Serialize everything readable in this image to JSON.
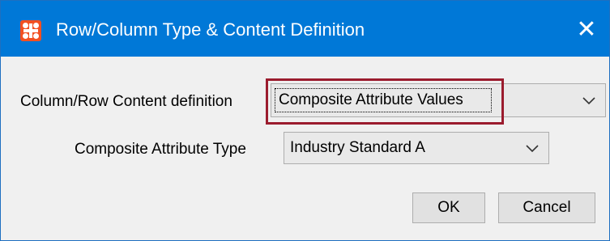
{
  "window": {
    "title": "Row/Column Type & Content Definition",
    "close_glyph": "✕",
    "accent_color": "#0078d7",
    "highlight_color": "#9b1c2e"
  },
  "form": {
    "content_definition": {
      "label": "Column/Row Content definition",
      "value": "Composite Attribute Values"
    },
    "attribute_type": {
      "label": "Composite Attribute Type",
      "value": "Industry Standard A"
    }
  },
  "buttons": {
    "ok": "OK",
    "cancel": "Cancel"
  },
  "icons": {
    "app": "app-grid-icon",
    "close": "close-icon",
    "dropdown": "chevron-down-icon"
  }
}
